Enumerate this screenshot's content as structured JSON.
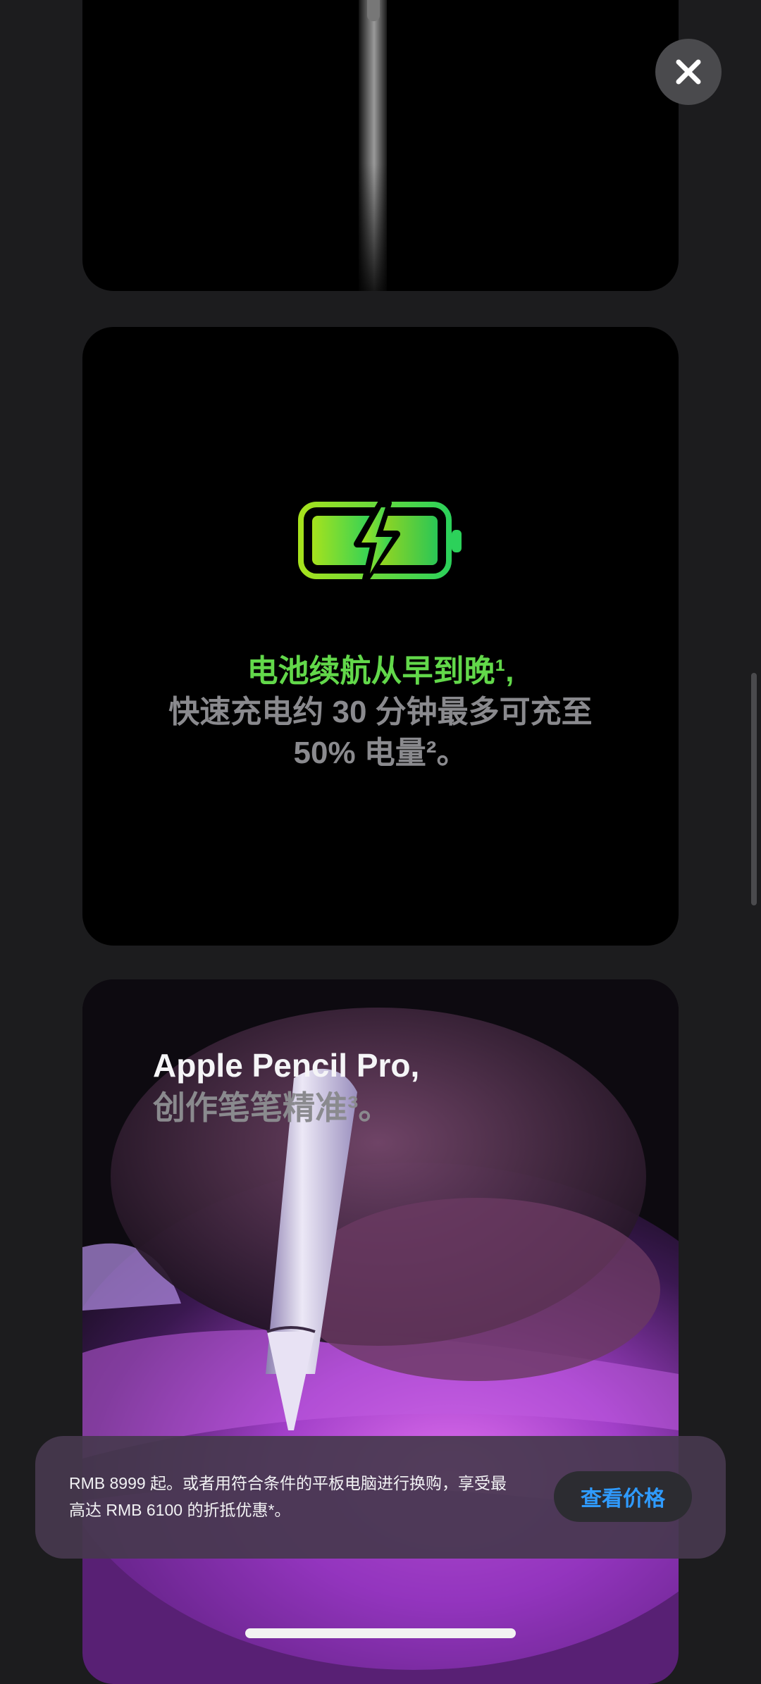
{
  "colors": {
    "page_background": "#1c1c1e",
    "accent_green": "#62d84a",
    "link_blue": "#2f9bff"
  },
  "close_icon": "close-icon",
  "battery_card": {
    "icon": "battery-charging-icon",
    "highlight": "电池续航从早到晚¹,",
    "line2": "快速充电约 30 分钟最多可充至",
    "line3": "50% 电量²。"
  },
  "pencil_card": {
    "title_line1": "Apple Pencil Pro,",
    "title_line2": "创作笔笔精准³。"
  },
  "price_bar": {
    "text": "RMB 8999 起。或者用符合条件的平板电脑进行换购，享受最高达 RMB 6100 的折抵优惠*。",
    "button_label": "查看价格"
  }
}
